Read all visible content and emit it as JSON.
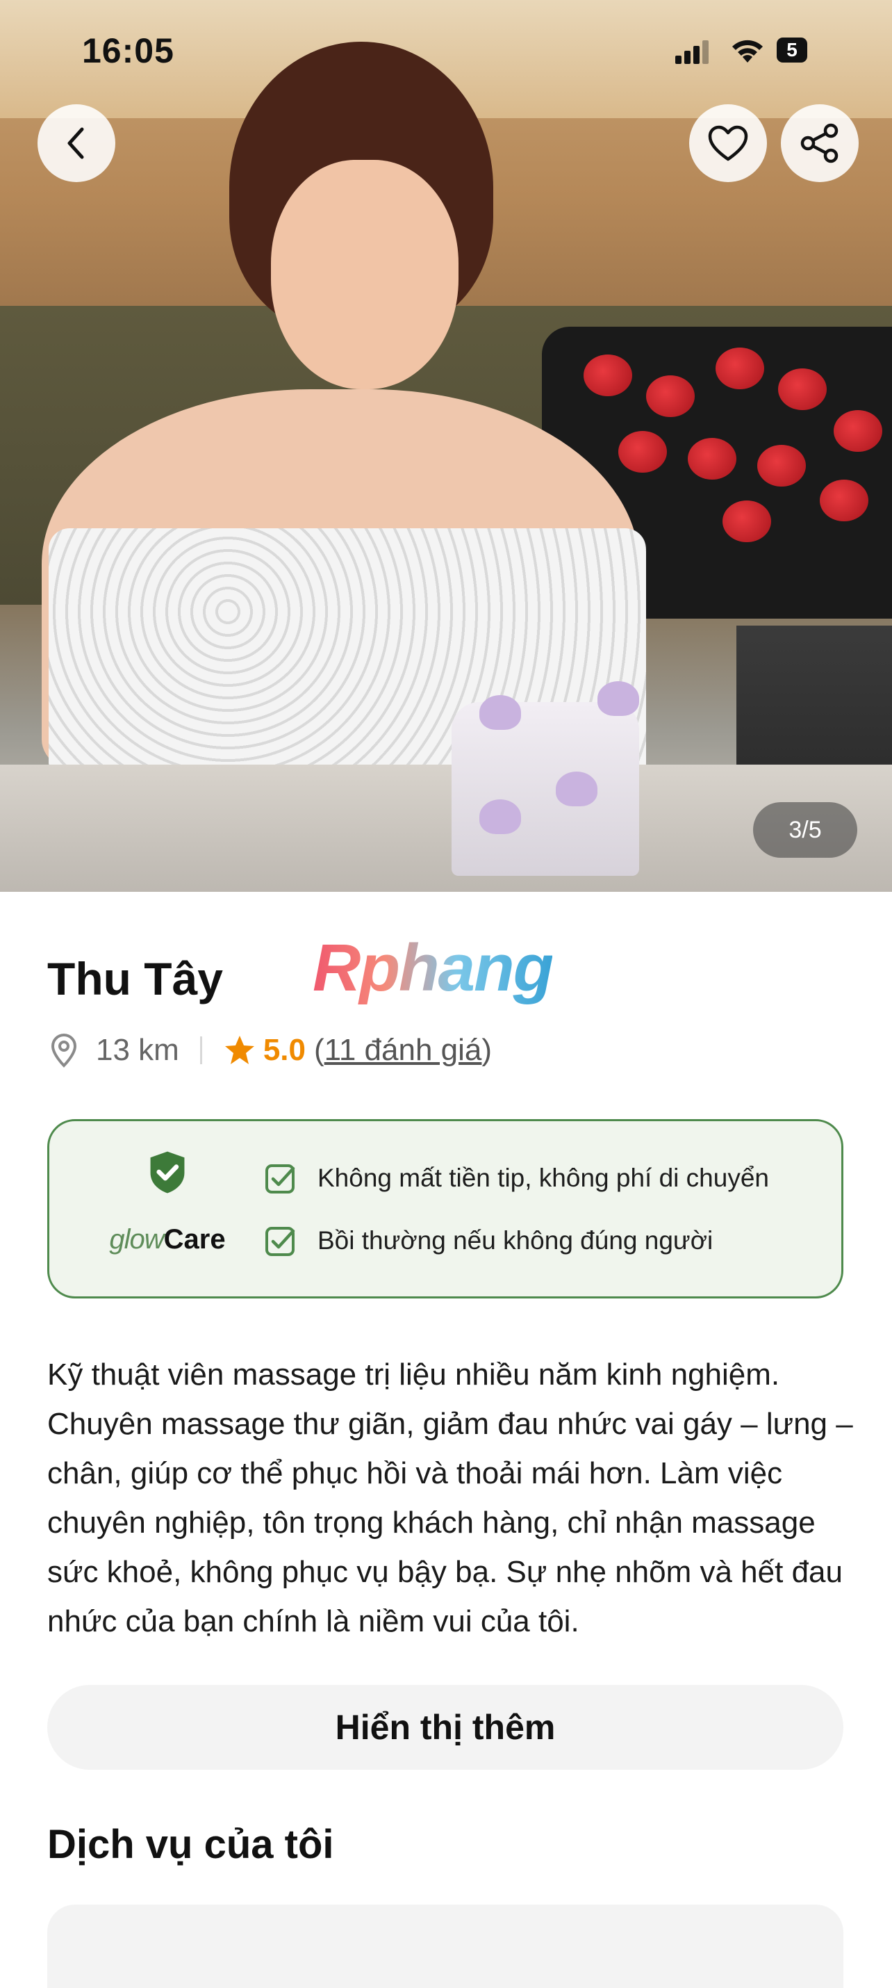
{
  "status_bar": {
    "time": "16:05",
    "battery": "5"
  },
  "gallery": {
    "counter": "3/5"
  },
  "profile": {
    "name": "Thu Tây",
    "watermark": "Rphang",
    "distance": "13 km",
    "rating": "5.0",
    "reviews": "11 đánh giá",
    "reviews_open": "(",
    "reviews_close": ")"
  },
  "care": {
    "brand_glow": "glow",
    "brand_care": "Care",
    "benefits": [
      "Không mất tiền tip, không phí di chuyển",
      "Bồi thường nếu không đúng người"
    ]
  },
  "bio": "Kỹ thuật viên massage trị liệu nhiều năm kinh nghiệm. Chuyên massage thư giãn, giảm đau nhức vai gáy – lưng – chân, giúp cơ thể phục hồi và thoải mái hơn. Làm việc chuyên nghiệp, tôn trọng khách hàng, chỉ nhận massage sức khoẻ, không phục vụ bậy bạ. Sự nhẹ nhõm và hết đau nhức của bạn chính là niềm vui của tôi.",
  "show_more_label": "Hiển thị thêm",
  "services_title": "Dịch vụ của tôi",
  "colors": {
    "accent_orange": "#f08a00",
    "care_green": "#4e8a4c",
    "care_bg": "#f0f5ed"
  },
  "icons": [
    "back-icon",
    "heart-icon",
    "share-icon",
    "location-pin-icon",
    "star-icon",
    "shield-check-icon",
    "checkbox-icon"
  ]
}
